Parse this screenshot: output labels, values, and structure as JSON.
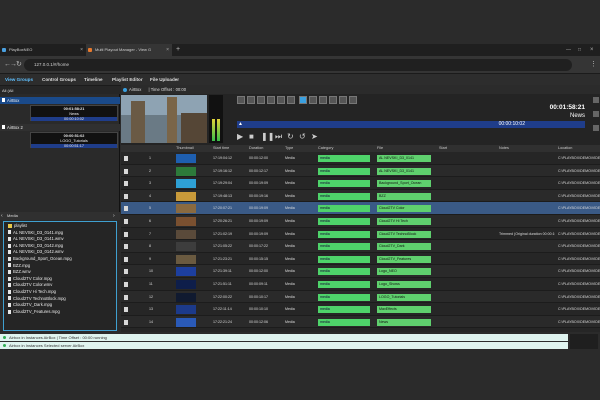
{
  "tabs": [
    {
      "label": "PlayBoxNEO"
    },
    {
      "label": "Multi Playout Manager - View G"
    }
  ],
  "address": {
    "url": "127.0.0.1/#/home"
  },
  "menu": [
    "View Groups",
    "Control Groups",
    "Timeline",
    "Playlist Editor",
    "File Uploader"
  ],
  "left": {
    "filter": "All (All",
    "groups": [
      {
        "name": "AirBox",
        "time": "00:01:58:21",
        "title": "News",
        "sub": "00:00:10:02"
      },
      {
        "name": "AirBox 2",
        "time": "00:00:51:02",
        "title": "LOGO_Tutorials",
        "sub": "00:00:51:17"
      }
    ]
  },
  "browser": {
    "label": "Media",
    "items": [
      "playlist",
      "AL NEVSKI_D3_0141.mpg",
      "AL NEVSKI_D3_0141.wmv",
      "AL NEVSKI_D3_0142.mpg",
      "AL NEVSKI_D3_0142.wmv",
      "Background_Sport_Ocean.mpg",
      "BZZ.mpg",
      "BZZ.wmv",
      "Cloud2TV Color.mpg",
      "Cloud2TV Color.wmv",
      "Cloud2TV Hi Tech.mpg",
      "Cloud2TV TechnoBlock.mpg",
      "Cloud2TV_Dark.mpg",
      "Cloud2TV_Features.mpg"
    ]
  },
  "player": {
    "channel": "AirBox",
    "offset": "| Time Offset : 00:00",
    "clock": "00:01:58:21",
    "title": "News",
    "remaining": "00:00:10:02"
  },
  "table": {
    "headers": [
      "Thumbnail",
      "Start time",
      "Duration",
      "Type",
      "Category",
      "File",
      "Start",
      "Notes",
      "Location"
    ],
    "rows": [
      {
        "n": "1",
        "start": "17:19:04:12",
        "dur": "00:00:12:00",
        "type": "Media",
        "cat": "media",
        "file": "AL NEVSKI_D3_0141",
        "notes": "",
        "loc": "C:\\PLAYBOX\\DEMO\\VIDEOS",
        "th": "#1e5fb0"
      },
      {
        "n": "2",
        "start": "17:19:16:12",
        "dur": "00:00:12:17",
        "type": "Media",
        "cat": "media",
        "file": "AL NEVSKI_D3_0141",
        "notes": "",
        "loc": "C:\\PLAYBOX\\DEMO\\VIDEOS",
        "th": "#2d7a3a"
      },
      {
        "n": "3",
        "start": "17:19:29:04",
        "dur": "00:00:19:09",
        "type": "Media",
        "cat": "media",
        "file": "Background_Sport_Ocean",
        "notes": "",
        "loc": "C:\\PLAYBOX\\DEMO\\VIDEOS",
        "th": "#2ea0d4"
      },
      {
        "n": "4",
        "start": "17:19:48:13",
        "dur": "00:00:19:16",
        "type": "Media",
        "cat": "media",
        "file": "BZZ",
        "notes": "",
        "loc": "C:\\PLAYBOX\\DEMO\\VIDEOS",
        "th": "#c89a3a"
      },
      {
        "n": "5",
        "start": "17:20:07:21",
        "dur": "00:00:19:09",
        "type": "Media",
        "cat": "media",
        "file": "Cloud2TV Color",
        "notes": "",
        "loc": "C:\\PLAYBOX\\DEMO\\VIDEOS",
        "th": "#8a6a40",
        "selected": true
      },
      {
        "n": "6",
        "start": "17:20:26:21",
        "dur": "00:00:19:09",
        "type": "Media",
        "cat": "media",
        "file": "Cloud2TV Hi Tech",
        "notes": "",
        "loc": "C:\\PLAYBOX\\DEMO\\VIDEOS",
        "th": "#7a5030"
      },
      {
        "n": "7",
        "start": "17:21:02:19",
        "dur": "00:00:19:09",
        "type": "Media",
        "cat": "media",
        "file": "Cloud2TV TechnoBlock",
        "notes": "Trimmed (Original duration 00:00:19:12)",
        "loc": "C:\\PLAYBOX\\DEMO\\VIDEOS",
        "th": "#5a4a3a"
      },
      {
        "n": "8",
        "start": "17:21:05:22",
        "dur": "00:00:17:22",
        "type": "Media",
        "cat": "media",
        "file": "Cloud2TV_Dark",
        "notes": "",
        "loc": "C:\\PLAYBOX\\DEMO\\VIDEOS",
        "th": "#3d3d3d"
      },
      {
        "n": "9",
        "start": "17:21:23:21",
        "dur": "00:00:15:15",
        "type": "Media",
        "cat": "media",
        "file": "Cloud2TV_Features",
        "notes": "",
        "loc": "C:\\PLAYBOX\\DEMO\\VIDEOS",
        "th": "#6a5a40"
      },
      {
        "n": "10",
        "start": "17:21:39:11",
        "dur": "00:00:12:00",
        "type": "Media",
        "cat": "media",
        "file": "Logo_NEO",
        "notes": "",
        "loc": "C:\\PLAYBOX\\DEMO\\VIDEOS",
        "th": "#1d3f9e"
      },
      {
        "n": "11",
        "start": "17:21:51:11",
        "dur": "00:00:09:11",
        "type": "Media",
        "cat": "media",
        "file": "Logo_Shows",
        "notes": "",
        "loc": "C:\\PLAYBOX\\DEMO\\VIDEOS",
        "th": "#0e1e4a"
      },
      {
        "n": "12",
        "start": "17:22:00:22",
        "dur": "00:00:10:17",
        "type": "Media",
        "cat": "media",
        "file": "LOGO_Tutorials",
        "notes": "",
        "loc": "C:\\PLAYBOX\\DEMO\\VIDEOS",
        "th": "#101a30"
      },
      {
        "n": "13",
        "start": "17:22:11:14",
        "dur": "00:00:10:10",
        "type": "Media",
        "cat": "media",
        "file": "MaxEffects",
        "notes": "",
        "loc": "C:\\PLAYBOX\\DEMO\\VIDEOS",
        "th": "#1c3a8a"
      },
      {
        "n": "14",
        "start": "17:22:21:24",
        "dur": "00:00:12:06",
        "type": "Media",
        "cat": "media",
        "file": "News",
        "notes": "",
        "loc": "C:\\PLAYBOX\\DEMO\\VIDEOS",
        "th": "#2a5ab8"
      }
    ]
  },
  "status": {
    "line1": "Airbox in Instances AirBox    | Time Offset : 00:00 running",
    "line2": "Airbox in Instances Selected server AirBox"
  },
  "colors": {
    "accent": "#4ed36a",
    "selected": "#3a5a86",
    "bluebar": "#1f3d8a"
  }
}
